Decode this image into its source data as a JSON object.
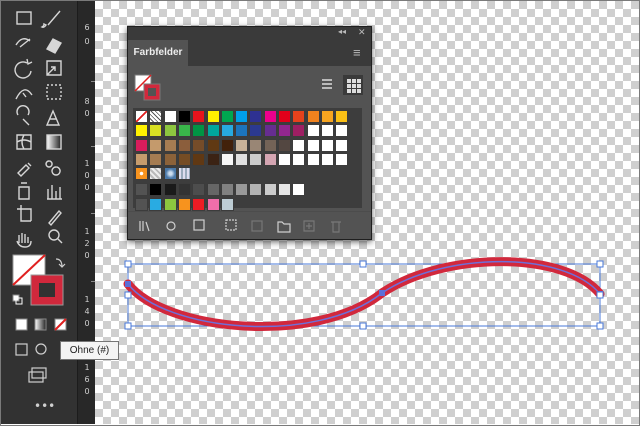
{
  "panel": {
    "tab_label": "Farbfelder",
    "collapse_glyph": "◂◂",
    "close_glyph": "✕",
    "menu_glyph": "≡",
    "swatch_rows": [
      [
        "none",
        "registration",
        "#ffffff",
        "#000000",
        "#e8141c",
        "#ffef00",
        "#00a650",
        "#00a0e9",
        "#2e3192",
        "#ec008c",
        "#e2001a",
        "#e5421c",
        "#f0821e",
        "#f7a520",
        "#fbc015"
      ],
      [
        "#fff200",
        "#d7df23",
        "#8dc63f",
        "#39b54a",
        "#009444",
        "#00a79d",
        "#27aae1",
        "#1c75bc",
        "#2b3990",
        "#662d91",
        "#92278f",
        "#9e1f63",
        "#ffffff",
        "#ffffff",
        "#ffffff"
      ],
      [
        "#da1c5c",
        "#c49a6c",
        "#a67c52",
        "#8b5e3c",
        "#754c29",
        "#603913",
        "#42210b",
        "#c7b299",
        "#998675",
        "#736357",
        "#534741",
        "#ffffff",
        "#ffffff",
        "#ffffff",
        "#ffffff"
      ],
      [
        "#c69c6d",
        "#a57c52",
        "#8c6239",
        "#754c24",
        "#603813",
        "#3b2314",
        "#f6f6f6",
        "#e0e0e0",
        "#cccccc",
        "#d4a5b2",
        "#ffffff",
        "#ffffff",
        "#ffffff",
        "#ffffff",
        "#ffffff"
      ]
    ],
    "pattern_row": [
      "pattern-orange",
      "pattern-check",
      "pattern-blue",
      "pattern-dots"
    ],
    "gray_row": [
      "#000000",
      "#1a1a1a",
      "#333333",
      "#4d4d4d",
      "#666666",
      "#808080",
      "#999999",
      "#b3b3b3",
      "#cccccc",
      "#e6e6e6",
      "#ffffff"
    ],
    "color_group_row": [
      "#29abe2",
      "#8cc63f",
      "#f7931e",
      "#ed1c24",
      "#f06eaa",
      "#bdccd4"
    ]
  },
  "tooltip": {
    "text": "Ohne (#)"
  },
  "ruler": {
    "labels": [
      "6",
      "0",
      "8",
      "0",
      "1",
      "0",
      "0",
      "1",
      "2",
      "0",
      "1",
      "4",
      "0",
      "1",
      "6",
      "0"
    ]
  },
  "colors": {
    "stroke": "#d1283c",
    "path": "#5d6fd8",
    "selection": "#4a78d8"
  }
}
